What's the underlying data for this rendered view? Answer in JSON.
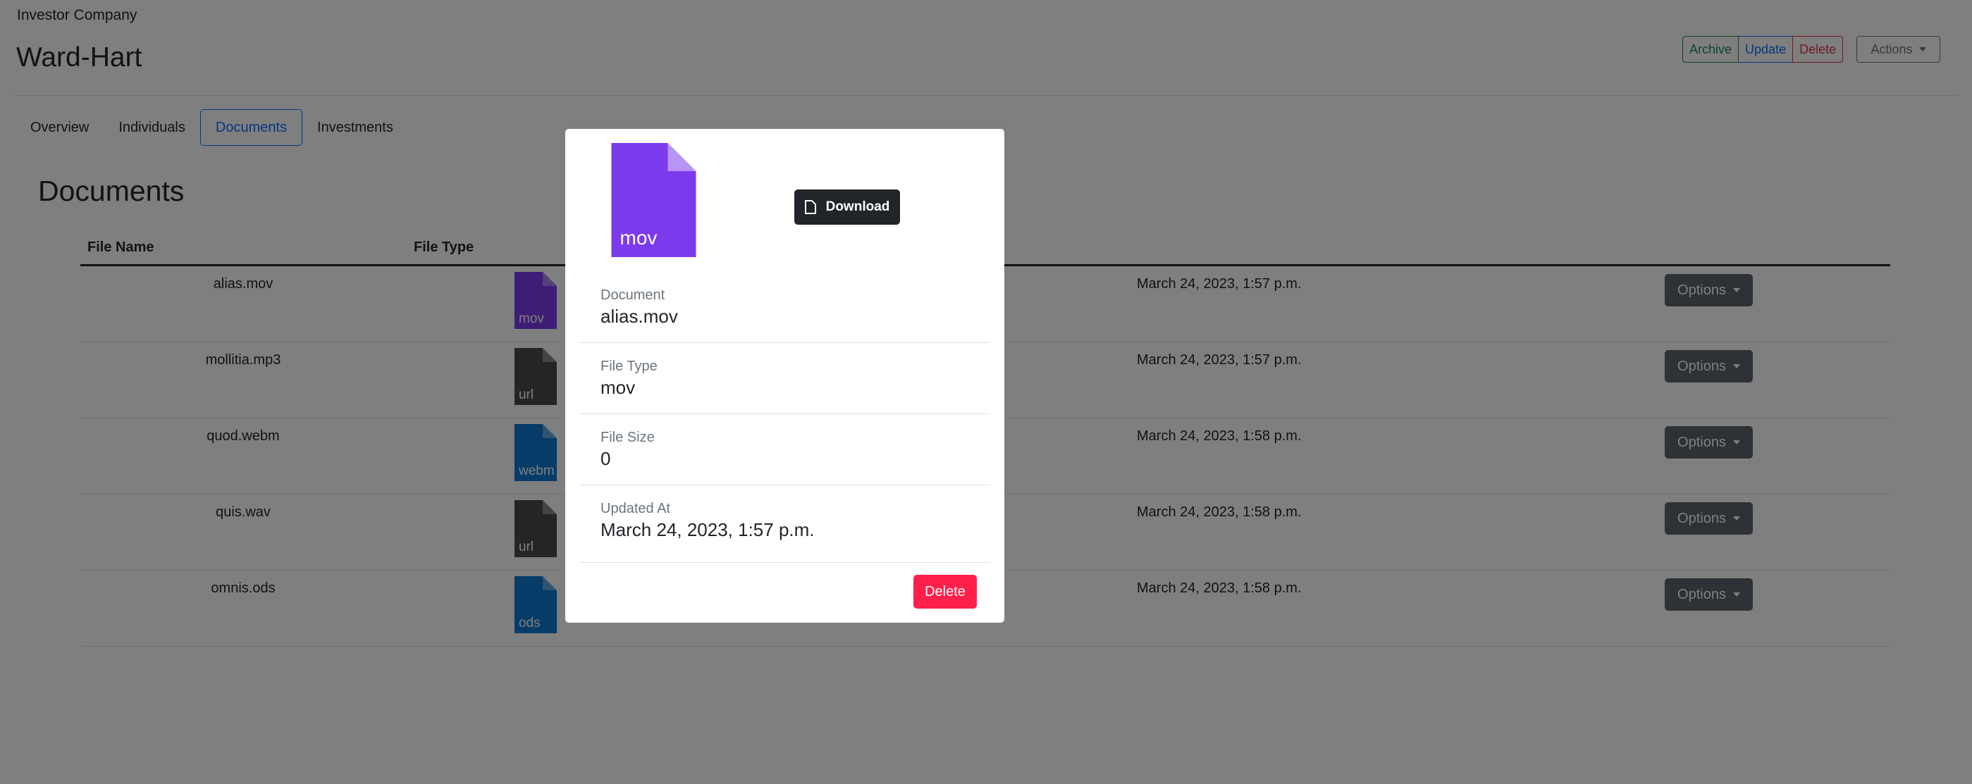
{
  "header": {
    "company_label": "Investor Company",
    "company_name": "Ward-Hart",
    "buttons": {
      "archive": "Archive",
      "update": "Update",
      "delete": "Delete",
      "actions": "Actions"
    }
  },
  "tabs": [
    "Overview",
    "Individuals",
    "Documents",
    "Investments"
  ],
  "active_tab": "Documents",
  "documents": {
    "heading": "Documents",
    "columns": [
      "File Name",
      "File Type"
    ],
    "rows": [
      {
        "name": "alias.mov",
        "type": "mov",
        "icon_color": "#7c3aed",
        "date": "March 24, 2023, 1:57 p.m.",
        "options": "Options"
      },
      {
        "name": "mollitia.mp3",
        "type": "url",
        "icon_color": "#4b4b4b",
        "date": "March 24, 2023, 1:57 p.m.",
        "options": "Options"
      },
      {
        "name": "quod.webm",
        "type": "webm",
        "icon_color": "#0b78d1",
        "date": "March 24, 2023, 1:58 p.m.",
        "options": "Options"
      },
      {
        "name": "quis.wav",
        "type": "url",
        "icon_color": "#4b4b4b",
        "date": "March 24, 2023, 1:58 p.m.",
        "options": "Options"
      },
      {
        "name": "omnis.ods",
        "type": "ods",
        "icon_color": "#0b78d1",
        "date": "March 24, 2023, 1:58 p.m.",
        "options": "Options"
      }
    ]
  },
  "modal": {
    "icon_label": "mov",
    "icon_color": "#7c3aed",
    "download_label": "Download",
    "details": [
      {
        "label": "Document",
        "value": "alias.mov"
      },
      {
        "label": "File Type",
        "value": "mov"
      },
      {
        "label": "File Size",
        "value": "0"
      },
      {
        "label": "Updated At",
        "value": "March 24, 2023, 1:57 p.m."
      }
    ],
    "delete_label": "Delete"
  },
  "colors": {
    "archive": "#198754",
    "update": "#0d6efd",
    "delete": "#dc3545",
    "danger": "#ff1f4b",
    "dark": "#212529"
  }
}
